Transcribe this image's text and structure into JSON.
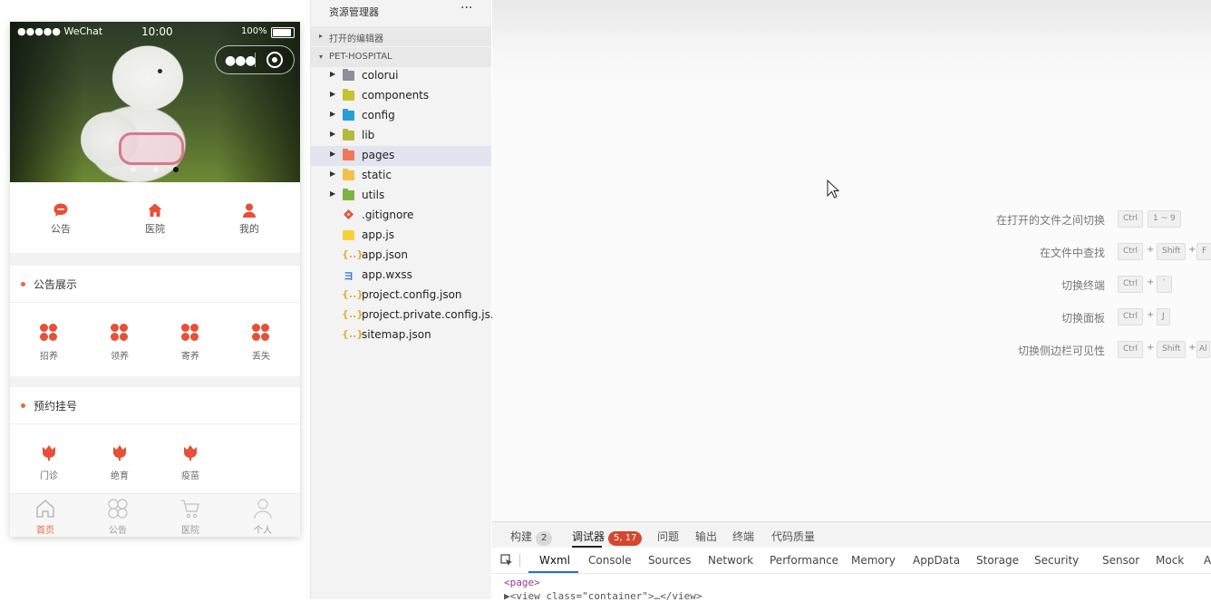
{
  "status_bar": {
    "signal": "●●●●● WeChat",
    "time": "10:00",
    "battery": "100%"
  },
  "nav_buttons": [
    {
      "label": "公告",
      "icon": "chat-bubble-icon"
    },
    {
      "label": "医院",
      "icon": "home-icon"
    },
    {
      "label": "我的",
      "icon": "user-icon"
    }
  ],
  "announce_section": {
    "title": "公告展示",
    "items": [
      {
        "label": "招养",
        "icon": "grid-icon"
      },
      {
        "label": "领养",
        "icon": "grid-icon"
      },
      {
        "label": "寄养",
        "icon": "grid-icon"
      },
      {
        "label": "丢失",
        "icon": "grid-icon"
      }
    ]
  },
  "booking_section": {
    "title": "预约挂号",
    "items": [
      {
        "label": "门诊",
        "icon": "tulip-icon"
      },
      {
        "label": "绝育",
        "icon": "tulip-icon"
      },
      {
        "label": "疫苗",
        "icon": "tulip-icon"
      }
    ]
  },
  "tabbar": [
    {
      "label": "首页",
      "icon": "home-outline-icon",
      "active": true
    },
    {
      "label": "公告",
      "icon": "grid-outline-icon",
      "active": false
    },
    {
      "label": "医院",
      "icon": "cart-icon",
      "active": false
    },
    {
      "label": "个人",
      "icon": "person-outline-icon",
      "active": false
    }
  ],
  "explorer": {
    "title": "资源管理器",
    "more": "···",
    "open_editors": "打开的编辑器",
    "project": "PET-HOSPITAL",
    "items": [
      {
        "name": "colorui",
        "type": "folder",
        "color": "#8a8f99"
      },
      {
        "name": "components",
        "type": "folder",
        "color": "#c5c233"
      },
      {
        "name": "config",
        "type": "folder",
        "color": "#2a9fd6"
      },
      {
        "name": "lib",
        "type": "folder",
        "color": "#b5b83a"
      },
      {
        "name": "pages",
        "type": "folder",
        "color": "#f0785a",
        "selected": true
      },
      {
        "name": "static",
        "type": "folder",
        "color": "#f2c14a"
      },
      {
        "name": "utils",
        "type": "folder",
        "color": "#7db343"
      },
      {
        "name": ".gitignore",
        "type": "git"
      },
      {
        "name": "app.js",
        "type": "js"
      },
      {
        "name": "app.json",
        "type": "json"
      },
      {
        "name": "app.wxss",
        "type": "css"
      },
      {
        "name": "project.config.json",
        "type": "json"
      },
      {
        "name": "project.private.config.js...",
        "type": "json"
      },
      {
        "name": "sitemap.json",
        "type": "json"
      }
    ]
  },
  "shortcuts": [
    {
      "label": "在打开的文件之间切换",
      "keys": [
        "Ctrl",
        "1 ~ 9"
      ]
    },
    {
      "label": "在文件中查找",
      "keys": [
        "Ctrl",
        "+",
        "Shift",
        "+",
        "F"
      ]
    },
    {
      "label": "切换终端",
      "keys": [
        "Ctrl",
        "+",
        "`"
      ]
    },
    {
      "label": "切换面板",
      "keys": [
        "Ctrl",
        "+",
        "J"
      ]
    },
    {
      "label": "切换侧边栏可见性",
      "keys": [
        "Ctrl",
        "+",
        "Shift",
        "+",
        "Al"
      ]
    }
  ],
  "devtools": {
    "top_tabs": [
      {
        "label": "构建",
        "badge": "2"
      },
      {
        "label": "调试器",
        "badge": "5, 17",
        "active": true
      },
      {
        "label": "问题"
      },
      {
        "label": "输出"
      },
      {
        "label": "终端"
      },
      {
        "label": "代码质量"
      }
    ],
    "panel_tabs": [
      "Wxml",
      "Console",
      "Sources",
      "Network",
      "Performance",
      "Memory",
      "AppData",
      "Storage",
      "Security",
      "Sensor",
      "Mock",
      "A"
    ],
    "code_lines": [
      "<page>",
      "▶<view class=\"container\">…</view>"
    ]
  }
}
